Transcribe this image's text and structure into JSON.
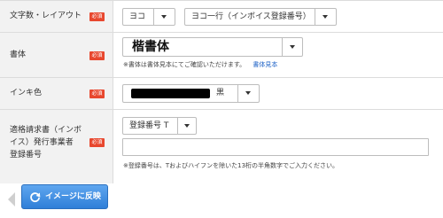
{
  "rows": {
    "layout": {
      "label": "文字数・レイアウト",
      "required": "必須",
      "orientation_value": "ヨコ",
      "layout_value": "ヨコ一行（インボイス登録番号）"
    },
    "font": {
      "label": "書体",
      "required": "必須",
      "font_value": "楷書体",
      "note": "※書体は書体見本にてご確認いただけます。",
      "sample_link": "書体見本"
    },
    "ink": {
      "label": "インキ色",
      "required": "必須",
      "color_value": "黒",
      "swatch_color": "#000000"
    },
    "invoice": {
      "label_line1": "適格請求書（インボ",
      "label_line2": "イス）発行事業者",
      "label_line3": "登録番号",
      "required": "必須",
      "prefix_value": "登録番号 T",
      "number_value": "",
      "note": "※登録番号は、Tおよびハイフンを除いた13桁の半角数字でご入力ください。"
    }
  },
  "footer": {
    "reflect_label": "イメージに反映",
    "button_color": "#3a8ae0"
  },
  "icons": {
    "refresh": "refresh-icon",
    "back": "back-arrow-icon",
    "dropdown": "chevron-down-icon"
  }
}
